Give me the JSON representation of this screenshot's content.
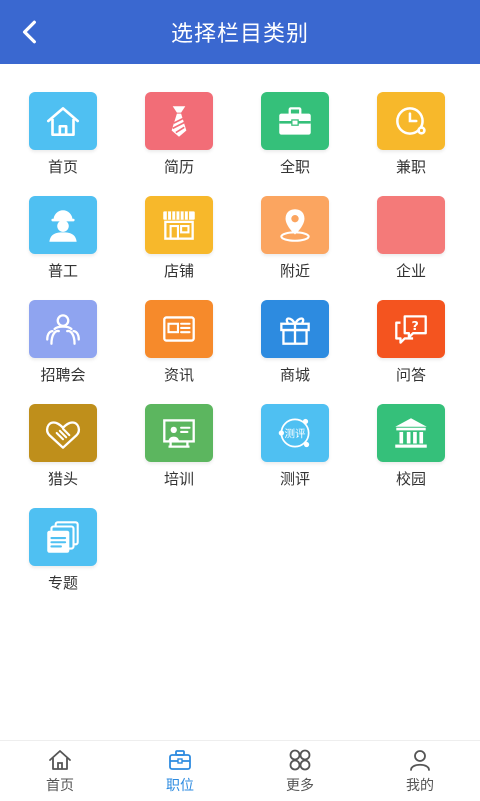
{
  "header": {
    "title": "选择栏目类别",
    "back_icon": "chevron-left-icon"
  },
  "colors": {
    "header_bg": "#3a68d0",
    "active_tab": "#2d8be0"
  },
  "categories": [
    {
      "label": "首页",
      "icon": "home-icon",
      "color": "#4fc0f2"
    },
    {
      "label": "简历",
      "icon": "necktie-icon",
      "color": "#f26d77"
    },
    {
      "label": "全职",
      "icon": "briefcase-icon",
      "color": "#35c07a"
    },
    {
      "label": "兼职",
      "icon": "clock-icon",
      "color": "#f7b82b"
    },
    {
      "label": "普工",
      "icon": "worker-icon",
      "color": "#4fc0f2"
    },
    {
      "label": "店铺",
      "icon": "storefront-icon",
      "color": "#f7b82b"
    },
    {
      "label": "附近",
      "icon": "location-pin-icon",
      "color": "#fba560"
    },
    {
      "label": "企业",
      "icon": "blank-icon",
      "color": "#f47a79"
    },
    {
      "label": "招聘会",
      "icon": "people-group-icon",
      "color": "#8fa4f0"
    },
    {
      "label": "资讯",
      "icon": "news-card-icon",
      "color": "#f68a2b"
    },
    {
      "label": "商城",
      "icon": "gift-icon",
      "color": "#2d8be0"
    },
    {
      "label": "问答",
      "icon": "question-chat-icon",
      "color": "#f4541f"
    },
    {
      "label": "猎头",
      "icon": "handshake-icon",
      "color": "#bf8f1b"
    },
    {
      "label": "培训",
      "icon": "teacher-board-icon",
      "color": "#5cb65f"
    },
    {
      "label": "测评",
      "icon": "assessment-icon",
      "color": "#4fc0f2",
      "icon_text": "测评"
    },
    {
      "label": "校园",
      "icon": "campus-icon",
      "color": "#35c07a"
    },
    {
      "label": "专题",
      "icon": "topic-stack-icon",
      "color": "#4fc0f2"
    }
  ],
  "tabs": [
    {
      "label": "首页",
      "icon": "home-outline-icon",
      "active": false
    },
    {
      "label": "职位",
      "icon": "briefcase-outline-icon",
      "active": true
    },
    {
      "label": "更多",
      "icon": "grid-more-icon",
      "active": false
    },
    {
      "label": "我的",
      "icon": "user-outline-icon",
      "active": false
    }
  ]
}
